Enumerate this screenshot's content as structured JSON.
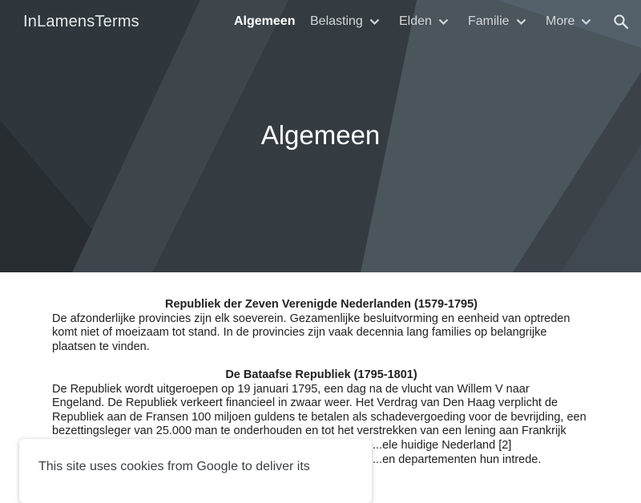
{
  "site": {
    "title": "InLamensTerms"
  },
  "nav": {
    "items": [
      {
        "label": "Algemeen",
        "active": true,
        "dropdown": false
      },
      {
        "label": "Belasting",
        "active": false,
        "dropdown": true
      },
      {
        "label": "Elden",
        "active": false,
        "dropdown": true
      },
      {
        "label": "Familie",
        "active": false,
        "dropdown": true
      },
      {
        "label": "More",
        "active": false,
        "dropdown": true
      }
    ],
    "search_icon": "search-icon"
  },
  "hero": {
    "title": "Algemeen"
  },
  "sections": [
    {
      "heading": "Republiek der Zeven Verenigde Nederlanden (1579-1795)",
      "lines": [
        "De afzonderlijke provincies zijn elk soeverein. Gezamenlijke besluitvorming en eenheid van optreden",
        "komt niet of moeizaam tot stand. In de provincies zijn vaak decennia lang families op belangrijke",
        "plaatsen te vinden."
      ]
    },
    {
      "heading": "De Bataafse Republiek (1795-1801)",
      "lines": [
        "De Republiek wordt uitgeroepen op 19 januari 1795, een dag na de vlucht van Willem V naar",
        "Engeland.  De Republiek verkeert financieel in zwaar weer. Het Verdrag van Den Haag verplicht de",
        "Republiek aan de Fransen 100 miljoen guldens te betalen als schadevergoeding voor de bevrijding, een",
        "bezettingsleger van 25.000 man te onderhouden en tot het verstrekken van een lening aan Frankrijk",
        "...ele huidige Nederland [2]",
        "...en departementen hun intrede."
      ]
    }
  ],
  "cookie": {
    "text": "This site uses cookies from Google to deliver its"
  },
  "colors": {
    "hero_bg": "#3a4248",
    "text": "#212121",
    "nav_text": "#d2d6d8"
  }
}
